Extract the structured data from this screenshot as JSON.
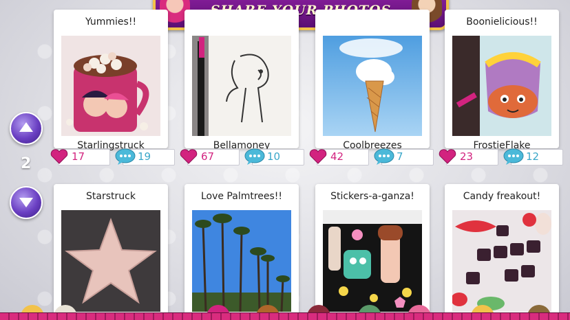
{
  "header": {
    "title": "SHARE YOUR PHOTOS"
  },
  "navigation": {
    "page": "2",
    "up_icon": "arrow-up-icon",
    "down_icon": "arrow-down-icon"
  },
  "colors": {
    "accent_purple": "#6a3fc2",
    "likes_pink": "#d2237f",
    "comments_blue": "#3aa7c9",
    "banner_gold": "#f2c24a"
  },
  "posts": [
    {
      "title": "Yummies!!",
      "author": "Starlingstruck",
      "likes": "17",
      "comments": "19"
    },
    {
      "title": "",
      "author": "Bellamoney",
      "likes": "67",
      "comments": "10"
    },
    {
      "title": "",
      "author": "Coolbreezes",
      "likes": "42",
      "comments": "7"
    },
    {
      "title": "Boonielicious!!",
      "author": "FrostieFlake",
      "likes": "23",
      "comments": "12"
    },
    {
      "title": "Starstruck"
    },
    {
      "title": "Love Palmtrees!!"
    },
    {
      "title": "Stickers-a-ganza!"
    },
    {
      "title": "Candy freakout!"
    }
  ]
}
